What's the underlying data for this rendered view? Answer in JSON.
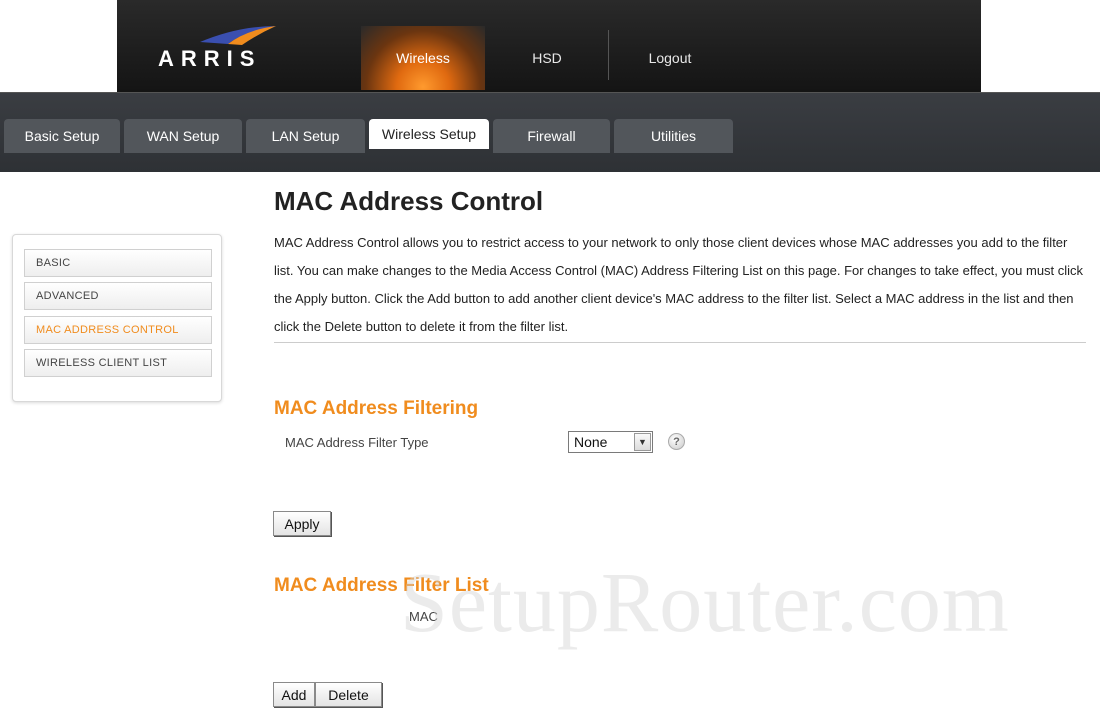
{
  "brand": {
    "logo_text": "ARRIS",
    "accent_color": "#f08c1e"
  },
  "topnav": {
    "items": [
      {
        "label": "Wireless",
        "active": true
      },
      {
        "label": "HSD",
        "active": false
      },
      {
        "label": "Logout",
        "active": false
      }
    ]
  },
  "tabs": [
    {
      "label": "Basic Setup",
      "active": false
    },
    {
      "label": "WAN Setup",
      "active": false
    },
    {
      "label": "LAN Setup",
      "active": false
    },
    {
      "label": "Wireless Setup",
      "active": true
    },
    {
      "label": "Firewall",
      "active": false
    },
    {
      "label": "Utilities",
      "active": false
    }
  ],
  "sidebar": {
    "items": [
      {
        "label": "BASIC",
        "active": false
      },
      {
        "label": "ADVANCED",
        "active": false
      },
      {
        "label": "MAC ADDRESS CONTROL",
        "active": true
      },
      {
        "label": "WIRELESS CLIENT LIST",
        "active": false
      }
    ]
  },
  "main": {
    "title": "MAC Address Control",
    "description": "MAC Address Control allows you to restrict access to your network to only those client devices whose MAC addresses you add to the filter list. You can make changes to the Media Access Control (MAC) Address Filtering List on this page. For changes to take effect, you must click the Apply button. Click the Add button to add another client device's MAC address to the filter list. Select a MAC address in the list and then click the Delete button to delete it from the filter list.",
    "filtering": {
      "title": "MAC Address Filtering",
      "filter_type_label": "MAC Address Filter Type",
      "filter_type_value": "None",
      "help_icon": "question-icon",
      "help_glyph": "?",
      "apply_label": "Apply"
    },
    "filter_list": {
      "title": "MAC Address Filter List",
      "columns": [
        "MAC"
      ],
      "add_label": "Add",
      "delete_label": "Delete"
    }
  },
  "watermark": "SetupRouter.com"
}
